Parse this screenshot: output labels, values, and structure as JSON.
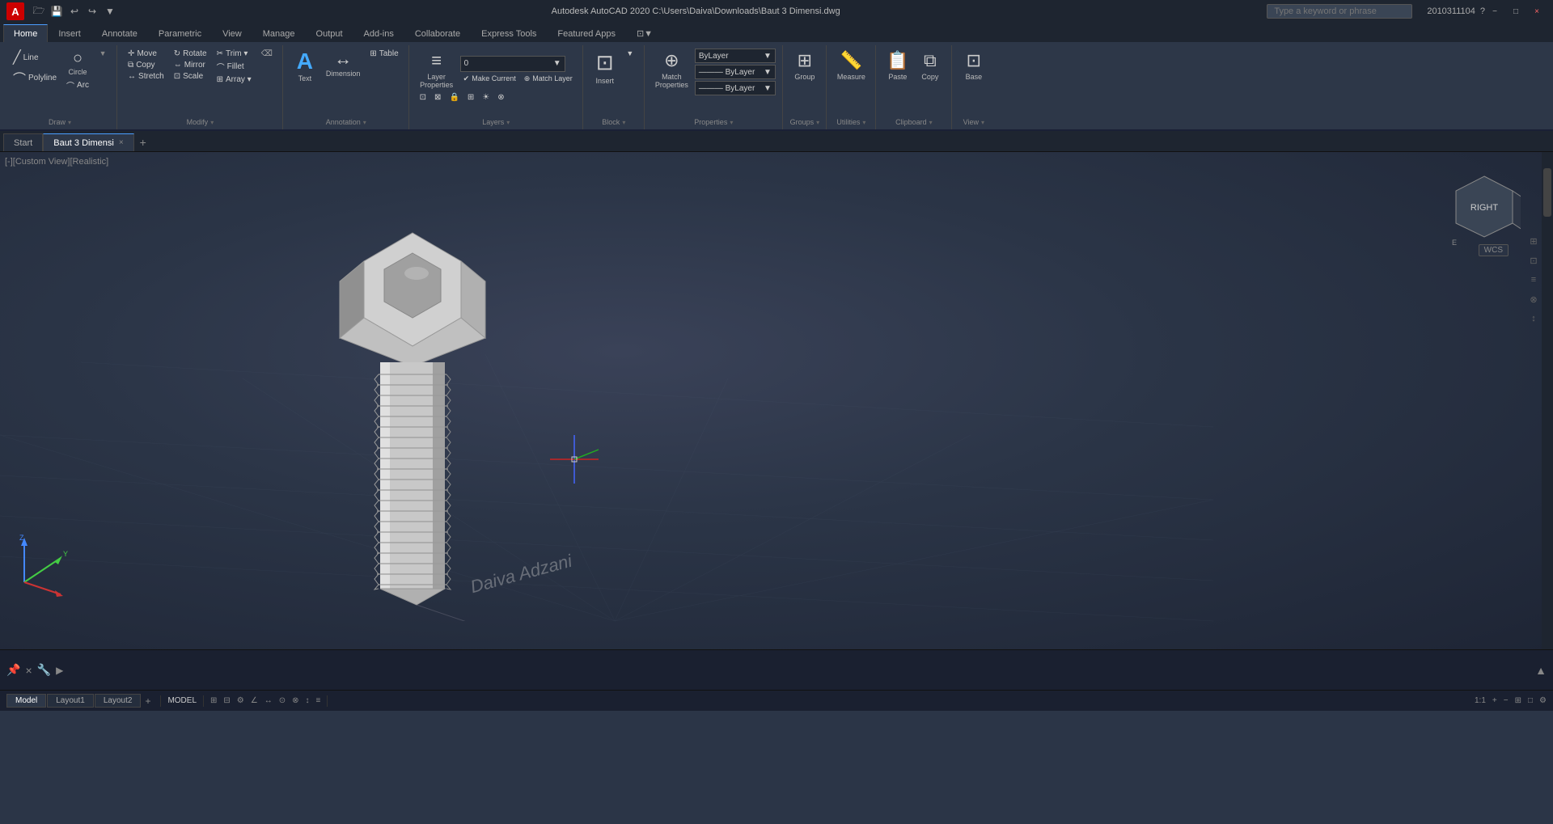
{
  "titlebar": {
    "app_letter": "A",
    "title": "Autodesk AutoCAD 2020    C:\\Users\\Daiva\\Downloads\\Baut 3 Dimensi.dwg",
    "search_placeholder": "Type a keyword or phrase",
    "user_id": "2010311104",
    "window_controls": [
      "−",
      "□",
      "×"
    ]
  },
  "quickaccess": {
    "buttons": [
      "🗁",
      "💾",
      "↩",
      "↪",
      "▼"
    ]
  },
  "ribbon": {
    "tabs": [
      "Home",
      "Insert",
      "Annotate",
      "Parametric",
      "View",
      "Manage",
      "Output",
      "Add-ins",
      "Collaborate",
      "Express Tools",
      "Featured Apps",
      "⊡▼"
    ],
    "active_tab": "Home",
    "groups": {
      "draw": {
        "label": "Draw",
        "buttons": [
          "Line",
          "Polyline",
          "Circle",
          "Arc"
        ]
      },
      "modify": {
        "label": "Modify",
        "buttons": [
          "Move",
          "Copy",
          "Stretch",
          "Rotate",
          "Mirror",
          "Fillet",
          "Scale",
          "Array",
          "Trim"
        ]
      },
      "annotation": {
        "label": "Annotation",
        "buttons": [
          "Text",
          "Dimension",
          "Table"
        ]
      },
      "layers": {
        "label": "Layers",
        "dropdown": "0",
        "buttons": [
          "Layer Properties",
          "Make Current",
          "Match Layer"
        ]
      },
      "block": {
        "label": "Block",
        "buttons": [
          "Insert"
        ]
      },
      "properties": {
        "label": "Properties",
        "buttons": [
          "Match Properties"
        ],
        "dropdowns": [
          "ByLayer",
          "ByLayer",
          "ByLayer"
        ]
      },
      "groups_group": {
        "label": "Groups",
        "buttons": [
          "Group"
        ]
      },
      "utilities": {
        "label": "Utilities",
        "buttons": [
          "Measure"
        ]
      },
      "clipboard": {
        "label": "Clipboard",
        "buttons": [
          "Paste",
          "Copy"
        ]
      },
      "view": {
        "label": "View"
      }
    }
  },
  "doc_tabs": {
    "tabs": [
      "Start",
      "Baut 3 Dimensi"
    ],
    "active": "Baut 3 Dimensi"
  },
  "viewport": {
    "label": "[-][Custom View][Realistic]",
    "watermark": "Daiva Adzani",
    "wcs_label": "WCS"
  },
  "command": {
    "prompt": ""
  },
  "status_bar": {
    "model_label": "MODEL",
    "items": [
      "MODEL",
      "⊞",
      "⊟",
      "⚙",
      "∠",
      "↔",
      "⊙",
      "⊗",
      "↕",
      "≡",
      "⊡",
      "1:1",
      "+",
      "−",
      "⊞",
      "□"
    ]
  },
  "layout_tabs": {
    "tabs": [
      "Model",
      "Layout1",
      "Layout2"
    ],
    "active": "Model"
  }
}
